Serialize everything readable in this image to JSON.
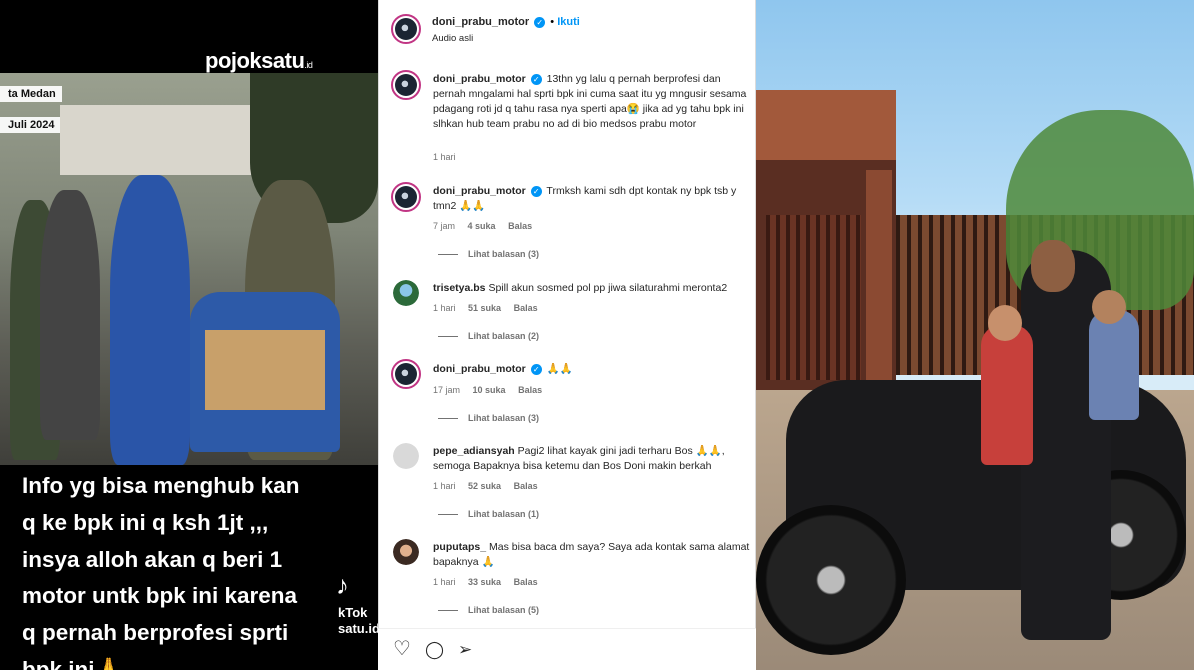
{
  "video": {
    "brand": "pojoksatu",
    "brand_suffix": ".id",
    "location_line1": "ta Medan",
    "location_line2": "Juli 2024",
    "caption_lines": [
      "Info yg bisa menghub kan",
      "q ke bpk ini q ksh 1jt ,,,",
      "insya alloh akan q beri 1",
      "motor untk bpk ini karena",
      "q pernah berprofesi sprti",
      "bpk ini🙏"
    ],
    "tiktok_line1": "kTok",
    "tiktok_line2": "satu.id"
  },
  "post": {
    "username": "doni_prabu_motor",
    "dot": "•",
    "follow_label": "Ikuti",
    "audio_label": "Audio asli"
  },
  "comments": [
    {
      "user": "doni_prabu_motor",
      "verified": true,
      "text": "13thn yg lalu q pernah berprofesi dan pernah mngalami hal sprti bpk ini cuma saat itu yg mngusir sesama pdagang roti jd q tahu rasa nya sperti apa😭 jika ad yg tahu bpk ini slhkan hub team prabu no ad di bio medsos prabu motor",
      "time": "1 hari"
    },
    {
      "user": "doni_prabu_motor",
      "verified": true,
      "text": "Trmksh kami sdh dpt kontak ny bpk tsb y tmn2 🙏🙏",
      "time": "7 jam",
      "likes": "4 suka",
      "reply": "Balas",
      "view_replies": "Lihat balasan (3)"
    },
    {
      "user": "trisetya.bs",
      "verified": false,
      "text": "Spill akun sosmed pol pp jiwa silaturahmi meronta2",
      "time": "1 hari",
      "likes": "51 suka",
      "reply": "Balas",
      "view_replies": "Lihat balasan (2)"
    },
    {
      "user": "doni_prabu_motor",
      "verified": true,
      "text": "🙏🙏",
      "time": "17 jam",
      "likes": "10 suka",
      "reply": "Balas",
      "view_replies": "Lihat balasan (3)"
    },
    {
      "user": "pepe_adiansyah",
      "verified": false,
      "text": "Pagi2 lihat kayak gini jadi terharu Bos 🙏🙏, semoga Bapaknya bisa ketemu dan Bos Doni makin berkah",
      "time": "1 hari",
      "likes": "52 suka",
      "reply": "Balas",
      "view_replies": "Lihat balasan (1)"
    },
    {
      "user": "puputaps_",
      "verified": false,
      "text": "Mas bisa baca dm saya? Saya ada kontak sama alamat bapaknya 🙏",
      "time": "1 hari",
      "likes": "33 suka",
      "reply": "Balas",
      "view_replies": "Lihat balasan (5)"
    }
  ],
  "actions": {
    "like_icon": "♡",
    "comment_icon": "◯",
    "share_icon": "➢"
  }
}
